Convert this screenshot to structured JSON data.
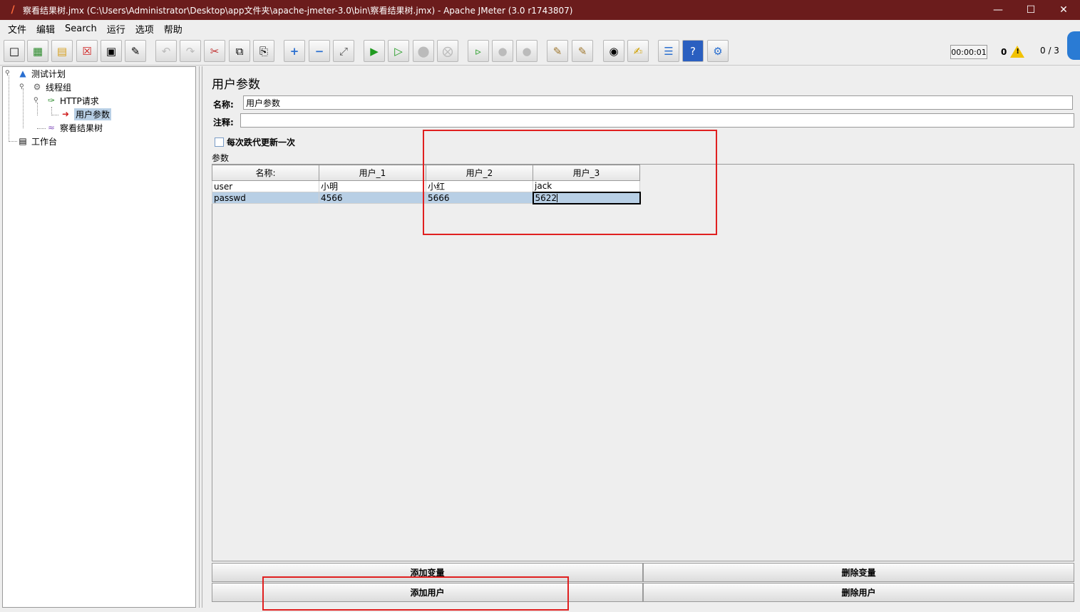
{
  "window": {
    "title": "察看结果树.jmx (C:\\Users\\Administrator\\Desktop\\app文件夹\\apache-jmeter-3.0\\bin\\察看结果树.jmx) - Apache JMeter (3.0 r1743807)",
    "minimize": "—",
    "maximize": "☐",
    "close": "✕"
  },
  "menu": [
    "文件",
    "编辑",
    "Search",
    "运行",
    "选项",
    "帮助"
  ],
  "status": {
    "elapsed": "00:00:01",
    "errors": "0",
    "threads": "0 / 3"
  },
  "tree": {
    "test_plan": "测试计划",
    "thread_group": "线程组",
    "http_request": "HTTP请求",
    "user_params": "用户参数",
    "result_tree": "察看结果树",
    "workbench": "工作台"
  },
  "panel": {
    "title": "用户参数",
    "name_label": "名称:",
    "name_value": "用户参数",
    "comment_label": "注释:",
    "comment_value": "",
    "per_iteration_label": "每次跌代更新一次",
    "per_iteration_checked": false,
    "params_label": "参数"
  },
  "table": {
    "headers": [
      "名称:",
      "用户_1",
      "用户_2",
      "用户_3"
    ],
    "rows": [
      [
        "user",
        "小明",
        "小红",
        "jack"
      ],
      [
        "passwd",
        "4566",
        "5666",
        "5622"
      ]
    ]
  },
  "buttons": {
    "add_variable": "添加变量",
    "delete_variable": "删除变量",
    "add_user": "添加用户",
    "delete_user": "删除用户"
  },
  "colors": {
    "titlebar": "#6b1c1c",
    "selection": "#b8cfe5",
    "highlight_box": "#e02020"
  }
}
